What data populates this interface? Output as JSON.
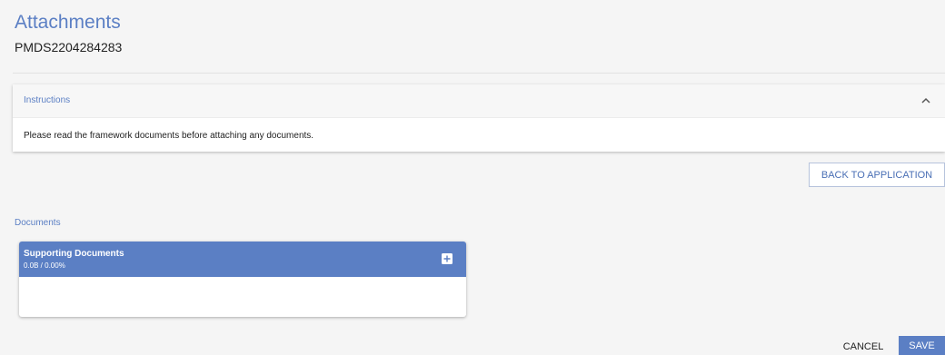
{
  "page": {
    "title": "Attachments",
    "reference": "PMDS2204284283"
  },
  "instructions": {
    "title": "Instructions",
    "text": "Please read the framework documents before attaching any documents.",
    "toggle_icon": "chevron-up-icon",
    "expanded": true
  },
  "actions": {
    "back_label": "BACK TO APPLICATION",
    "cancel_label": "CANCEL",
    "save_label": "SAVE"
  },
  "documents": {
    "label": "Documents",
    "groups": [
      {
        "title": "Supporting Documents",
        "size": "0.0B / 0.00%",
        "add_icon": "plus-square-icon"
      }
    ]
  },
  "colors": {
    "accent": "#5b7fc4",
    "background": "#f5f5f5",
    "panel": "#ffffff"
  }
}
